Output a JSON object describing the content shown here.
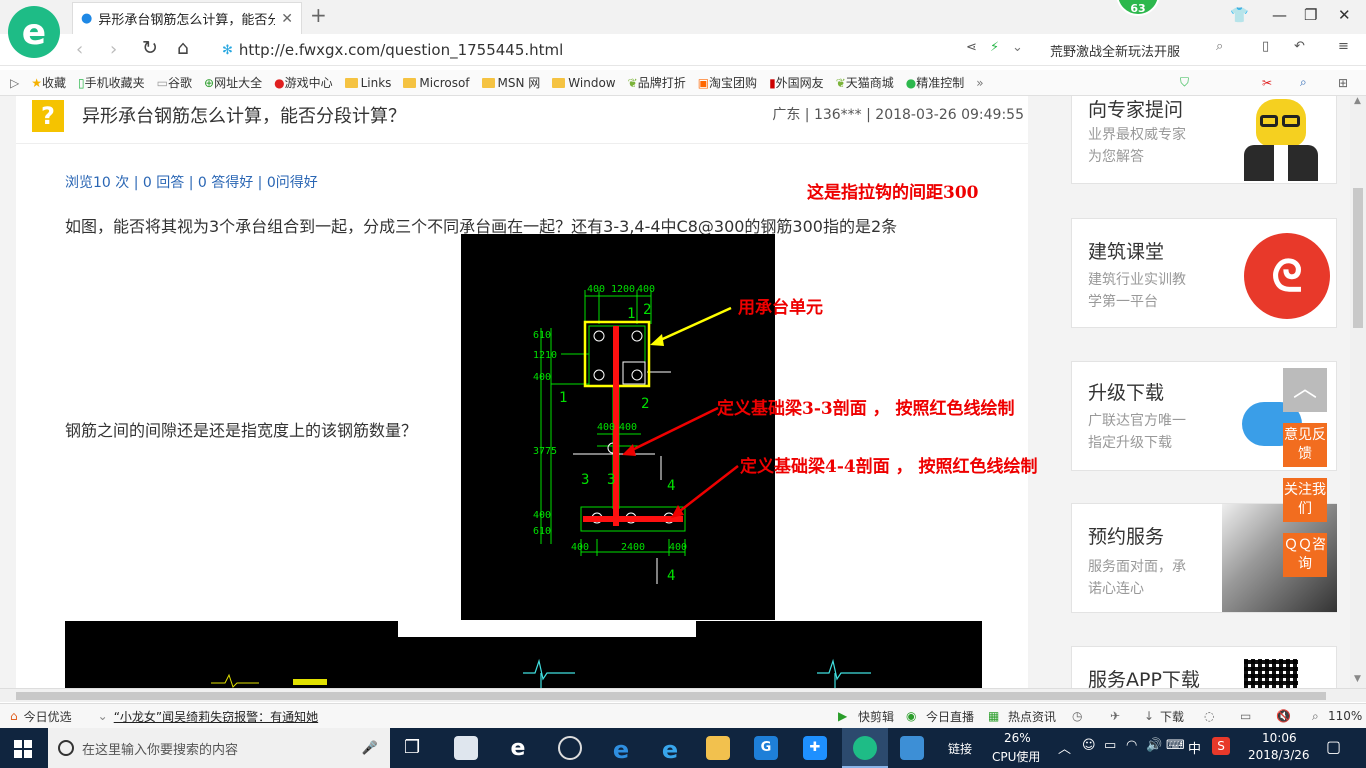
{
  "browser": {
    "tab_title": "异形承台钢筋怎么计算，能否分段计算？",
    "new_tab": "+",
    "badge": "63",
    "url": "http://e.fwxgx.com/question_1755445.html",
    "news_ticker": "荒野激战全新玩法开服",
    "colors": {
      "accent": "#1ebc86",
      "orange": "#f26d1f",
      "red": "#e00000"
    }
  },
  "bookmarks": [
    {
      "label": "收藏",
      "icon": "star-icon"
    },
    {
      "label": "手机收藏夹",
      "icon": "phone-icon"
    },
    {
      "label": "谷歌",
      "icon": "page-icon"
    },
    {
      "label": "网址大全",
      "icon": "plus-circle-icon"
    },
    {
      "label": "游戏中心",
      "icon": "game-icon"
    },
    {
      "label": "Links",
      "icon": "folder-icon"
    },
    {
      "label": "Microsof",
      "icon": "folder-icon"
    },
    {
      "label": "MSN 网",
      "icon": "folder-icon"
    },
    {
      "label": "Window",
      "icon": "folder-icon"
    },
    {
      "label": "品牌打折",
      "icon": "leaf-icon"
    },
    {
      "label": "淘宝团购",
      "icon": "tao-icon"
    },
    {
      "label": "外国网友",
      "icon": "flag-icon"
    },
    {
      "label": "天猫商城",
      "icon": "leaf-icon"
    },
    {
      "label": "精准控制",
      "icon": "chat-icon"
    }
  ],
  "question": {
    "title": "异形承台钢筋怎么计算，能否分段计算？",
    "meta": "广东 | 136*** | 2018-03-26 09:49:55",
    "stats": "浏览10 次 | 0 回答 | 0 答得好 | 0问得好",
    "body_line1": "如图，能否将其视为3个承台组合到一起，分成三个不同承台画在一起？还有3-3,4-4中C8@300的钢筋300指的是2条",
    "body_line2": "钢筋之间的间隙还是还是指宽度上的该钢筋数量？"
  },
  "annotations": {
    "a1": "这是指拉钩的间距300",
    "a2": "用承台单元",
    "a3": "定义基础梁3-3剖面 ，  按照红色线绘制",
    "a4": "定义基础梁4-4剖面 ，  按照红色线绘制"
  },
  "cad": {
    "dim_top": [
      "400",
      "1200",
      "400"
    ],
    "dim_bottom": [
      "400",
      "2400",
      "400"
    ],
    "left_dims": [
      "610",
      "1210",
      "400",
      "3775",
      "400",
      "610"
    ],
    "mid_dims": [
      "400",
      "400"
    ],
    "labels": [
      "2",
      "1",
      "1",
      "2",
      "3",
      "3",
      "4",
      "4"
    ]
  },
  "sidebar": [
    {
      "title": "向专家提问",
      "sub": [
        "业界最权威专家",
        "为您解答"
      ]
    },
    {
      "title": "建筑课堂",
      "sub": [
        "建筑行业实训教",
        "学第一平台"
      ]
    },
    {
      "title": "升级下载",
      "sub": [
        "广联达官方唯一",
        "指定升级下载"
      ]
    },
    {
      "title": "预约服务",
      "sub": [
        "服务面对面，承",
        "诺心连心"
      ]
    },
    {
      "title": "服务APP下载",
      "sub": []
    }
  ],
  "float_buttons": {
    "top": "︿",
    "feedback": "意见反馈",
    "follow": "关注我们",
    "qq": "ＱＱ咨询"
  },
  "statusbar": {
    "today": "今日优选",
    "news": "“小龙女”闻吴绮莉失窃报警：有通知她",
    "items": [
      "快剪辑",
      "今日直播",
      "热点资讯",
      "下载"
    ],
    "zoom": "110%"
  },
  "taskbar": {
    "search_placeholder": "在这里输入你要搜索的内容",
    "link": "链接",
    "cpu_pct": "26%",
    "cpu_label": "CPU使用",
    "ime": "中",
    "time": "10:06",
    "date": "2018/3/26"
  }
}
